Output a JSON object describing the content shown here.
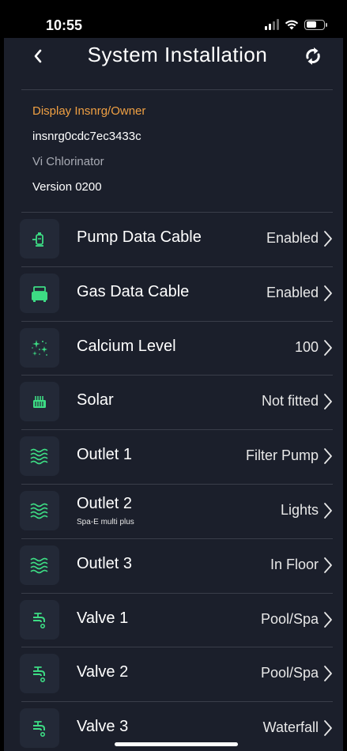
{
  "status_bar": {
    "time": "10:55",
    "icons": [
      "cellular-signal-icon",
      "wifi-icon",
      "battery-icon"
    ]
  },
  "nav": {
    "title": "System Installation",
    "back_icon": "chevron-left-icon",
    "refresh_icon": "refresh-icon"
  },
  "info": {
    "owner_label": "Display Insnrg/Owner",
    "serial": "insnrg0cdc7ec3433c",
    "product": "Vi Chlorinator",
    "version": "Version 0200"
  },
  "colors": {
    "background": "#1b1f2b",
    "accent_orange": "#f0a043",
    "icon_green": "#3ddc84",
    "icon_bg": "#232937",
    "divider": "#3a3e4a"
  },
  "items": [
    {
      "label": "Pump Data Cable",
      "value": "Enabled",
      "icon": "pump-icon"
    },
    {
      "label": "Gas Data Cable",
      "value": "Enabled",
      "icon": "gas-heater-icon"
    },
    {
      "label": "Calcium Level",
      "value": "100",
      "icon": "sparkle-icon"
    },
    {
      "label": "Solar",
      "value": "Not fitted",
      "icon": "solar-heater-icon"
    },
    {
      "label": "Outlet 1",
      "value": "Filter Pump",
      "icon": "water-waves-icon"
    },
    {
      "label": "Outlet 2",
      "sublabel": "Spa-E multi plus",
      "value": "Lights",
      "icon": "water-waves-icon"
    },
    {
      "label": "Outlet 3",
      "value": "In Floor",
      "icon": "water-waves-icon"
    },
    {
      "label": "Valve 1",
      "value": "Pool/Spa",
      "icon": "valve-icon"
    },
    {
      "label": "Valve 2",
      "value": "Pool/Spa",
      "icon": "valve-icon"
    },
    {
      "label": "Valve 3",
      "value": "Waterfall",
      "icon": "valve-icon"
    }
  ]
}
